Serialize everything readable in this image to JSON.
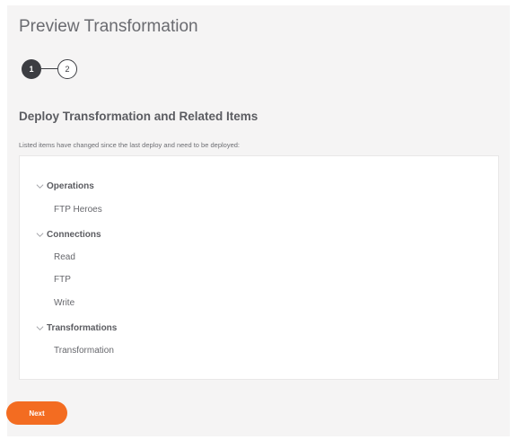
{
  "page": {
    "title": "Preview Transformation"
  },
  "stepper": {
    "steps": [
      "1",
      "2"
    ],
    "active": 1
  },
  "section": {
    "heading": "Deploy Transformation and Related Items",
    "note": "Listed items have changed since the last deploy and need to be deployed:"
  },
  "groups": [
    {
      "label": "Operations",
      "items": [
        "FTP Heroes"
      ]
    },
    {
      "label": "Connections",
      "items": [
        "Read",
        "FTP",
        "Write"
      ]
    },
    {
      "label": "Transformations",
      "items": [
        "Transformation"
      ]
    }
  ],
  "actions": {
    "next_label": "Next"
  },
  "colors": {
    "accent": "#f36c21",
    "step_active": "#3c3d42",
    "panel_bg": "#f5f4f4"
  },
  "icons": {
    "group_toggle": "chevron-down-icon"
  }
}
